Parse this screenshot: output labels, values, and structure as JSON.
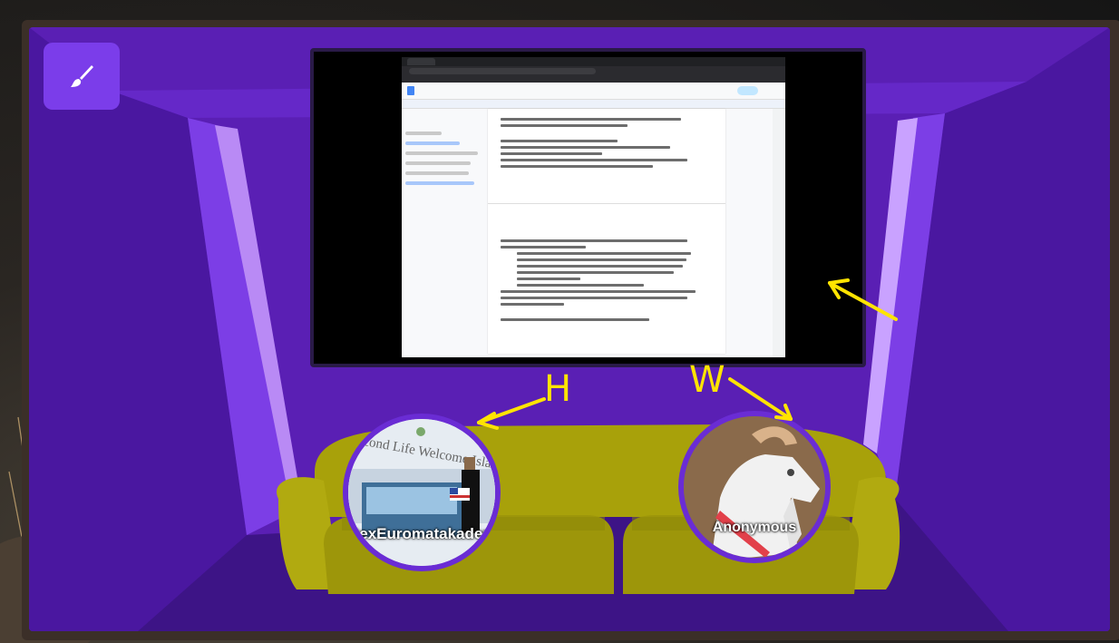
{
  "colors": {
    "room_purple": "#5a1fb4",
    "annotation_yellow": "#ffe400",
    "couch_olive": "#a8a10a",
    "avatar_ring": "#6a2cd4"
  },
  "toolbar": {
    "brush_icon": "paintbrush-icon"
  },
  "annotations": {
    "label_h": "H",
    "label_w": "W"
  },
  "participants": [
    {
      "name": "DexEuromatakademicki",
      "avatar": "photo-avatar"
    },
    {
      "name": "Anonymous",
      "avatar": "goat-icon"
    }
  ],
  "shared_screen": {
    "sign_text": "Second Life Welcome Island"
  }
}
